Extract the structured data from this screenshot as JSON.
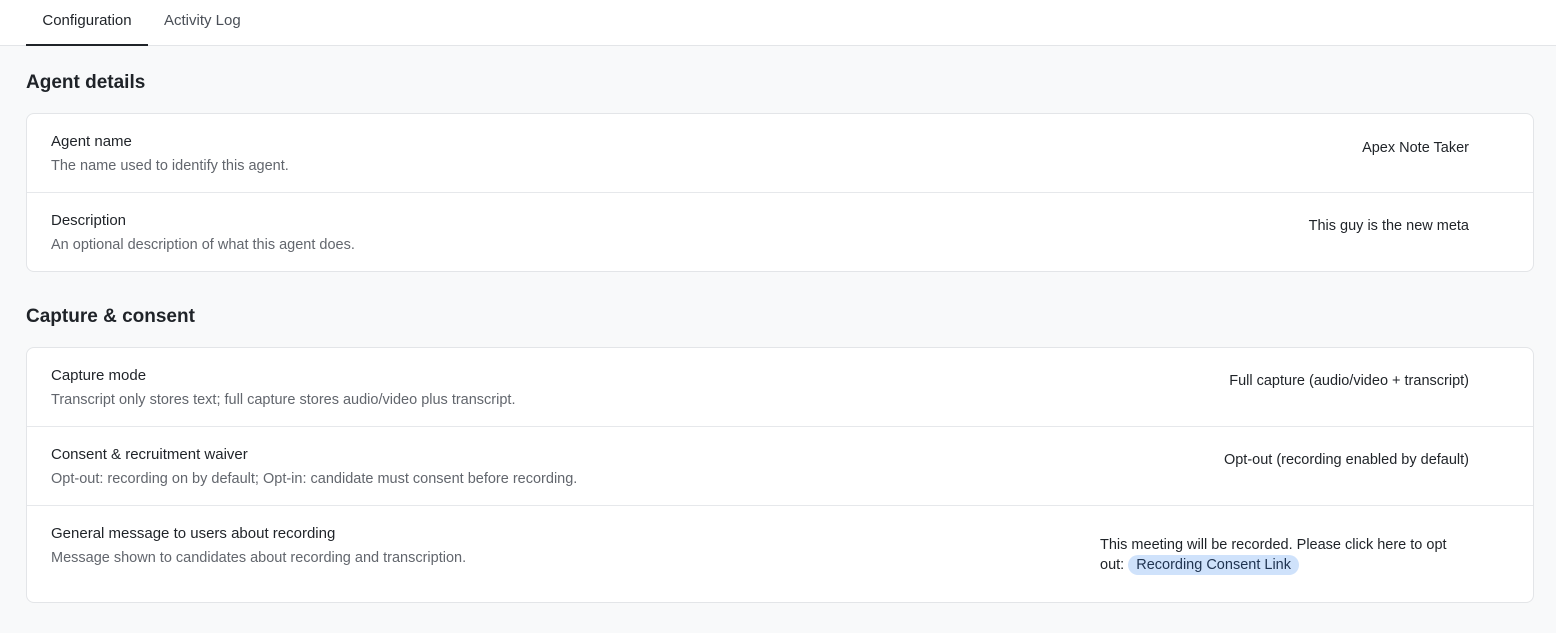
{
  "tabs": [
    {
      "label": "Configuration",
      "active": true
    },
    {
      "label": "Activity Log",
      "active": false
    }
  ],
  "agent_details": {
    "title": "Agent details",
    "rows": [
      {
        "label": "Agent name",
        "desc": "The name used to identify this agent.",
        "value": "Apex Note Taker"
      },
      {
        "label": "Description",
        "desc": "An optional description of what this agent does.",
        "value": "This guy is the new meta"
      }
    ]
  },
  "capture_consent": {
    "title": "Capture & consent",
    "rows": [
      {
        "label": "Capture mode",
        "desc": "Transcript only stores text; full capture stores audio/video plus transcript.",
        "value": "Full capture (audio/video + transcript)"
      },
      {
        "label": "Consent & recruitment waiver",
        "desc": "Opt-out: recording on by default; Opt-in: candidate must consent before recording.",
        "value": "Opt-out (recording enabled by default)"
      },
      {
        "label": "General message to users about recording",
        "desc": "Message shown to candidates about recording and transcription.",
        "value_text": "This meeting will be recorded. Please click here to opt out:",
        "value_link": "Recording Consent Link"
      }
    ]
  },
  "colors": {
    "page_bg": "#f8f9fa",
    "card_bg": "#ffffff",
    "border": "#e3e5e8",
    "chip_bg": "#cfe2fb"
  }
}
